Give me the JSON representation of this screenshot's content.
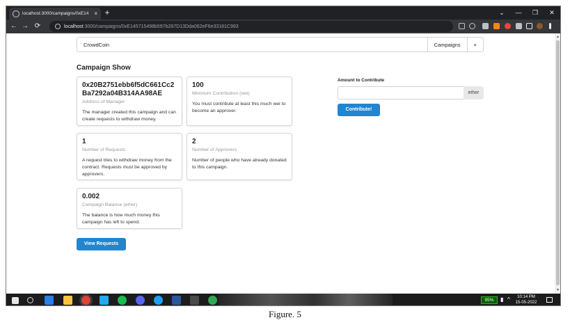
{
  "browser": {
    "tab_title": "localhost:3000/campaigns/0xE14",
    "tab_close": "×",
    "new_tab": "+",
    "window_controls": [
      "⌄",
      "—",
      "❐",
      "✕"
    ],
    "nav": {
      "back": "←",
      "forward": "→",
      "reload": "⟳"
    },
    "url_host": "localhost",
    "url_path": ":3000/campaigns/0xE145715498b597b287D13Dda062eF6e33181C993"
  },
  "menu": {
    "brand": "CrowdCoin",
    "campaigns": "Campaigns",
    "add": "+"
  },
  "page_title": "Campaign Show",
  "cards": [
    {
      "header": "0x20B2751ebb6f5dC661Cc2Ba7292a04B314AA98AE",
      "meta": "Address of Manager",
      "description": "The manager created this campaign and can create requests to withdraw money."
    },
    {
      "header": "100",
      "meta": "Minimum Contribution (wei)",
      "description": "You must contribute at least this much wei to become an approver."
    },
    {
      "header": "1",
      "meta": "Number of Requests",
      "description": "A request tries to withdraw money from the contract. Requests must be approved by approvers."
    },
    {
      "header": "2",
      "meta": "Number of Approvers",
      "description": "Number of people who have already donated to this campaign."
    },
    {
      "header": "0.002",
      "meta": "Campaign Balance (ether)",
      "description": "The balance is how much money this campaign has left to spend."
    }
  ],
  "contribute": {
    "label": "Amount to Contribute",
    "value": "",
    "unit": "ether",
    "button": "Contribute!"
  },
  "view_requests": "View Requests",
  "taskbar": {
    "battery": "95%",
    "time": "10:14 PM",
    "date": "15-05-2022"
  },
  "caption": "Figure. 5",
  "colors": {
    "primary_button": "#2185d0",
    "chrome_dark": "#202124",
    "chrome_toolbar": "#35363a"
  }
}
